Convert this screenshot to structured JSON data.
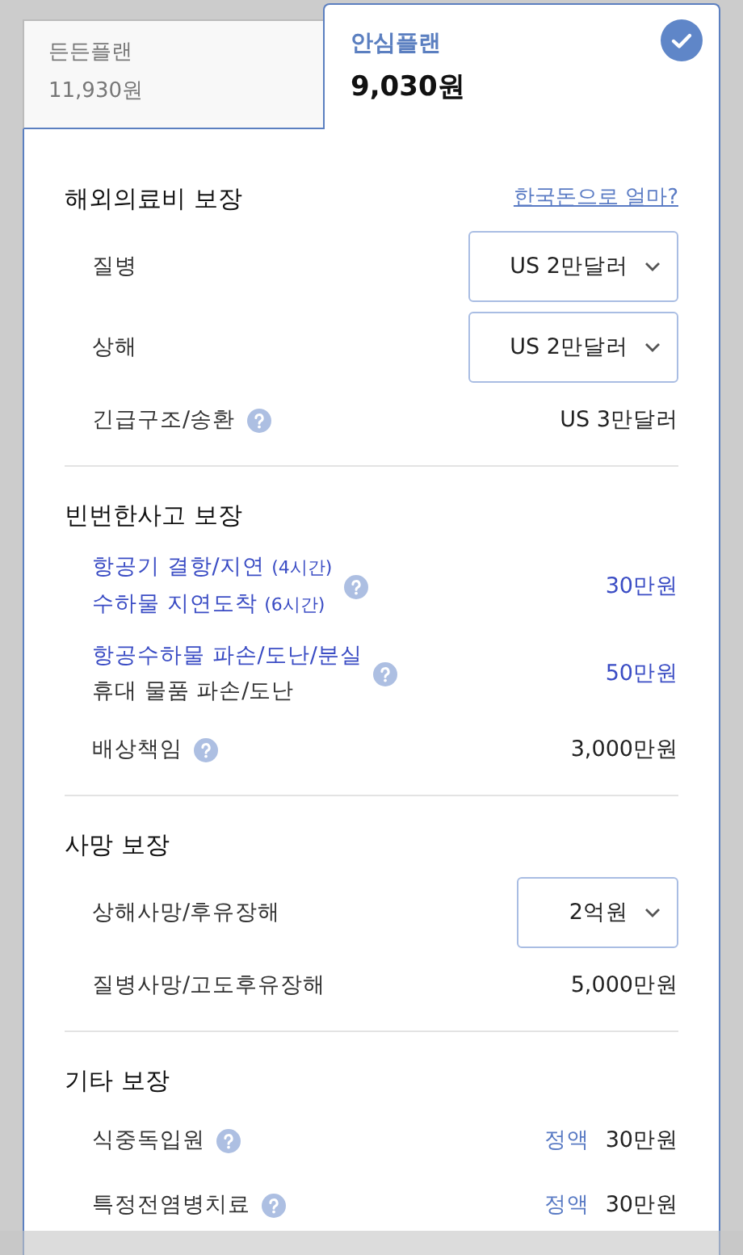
{
  "tabs": [
    {
      "name": "든든플랜",
      "price": "11,930원",
      "selected": false
    },
    {
      "name": "안심플랜",
      "price": "9,030원",
      "selected": true
    }
  ],
  "sections": [
    {
      "title": "해외의료비 보장",
      "link": "한국돈으로 얼마?",
      "items": [
        {
          "kind": "select",
          "lines": [
            {
              "text": "질병",
              "highlight": false
            }
          ],
          "help": false,
          "value": "US 2만달러",
          "highlight": false
        },
        {
          "kind": "select",
          "lines": [
            {
              "text": "상해",
              "highlight": false
            }
          ],
          "help": false,
          "value": "US 2만달러",
          "highlight": false
        },
        {
          "kind": "text",
          "lines": [
            {
              "text": "긴급구조/송환",
              "highlight": false
            }
          ],
          "help": true,
          "value": "US 3만달러",
          "highlight": false
        }
      ]
    },
    {
      "title": "빈번한사고 보장",
      "items": [
        {
          "kind": "text",
          "lines": [
            {
              "text": "항공기 결항/지연",
              "note": "(4시간)",
              "highlight": true
            },
            {
              "text": "수하물 지연도착",
              "note": "(6시간)",
              "highlight": true
            }
          ],
          "help": true,
          "value": "30만원",
          "highlight": true
        },
        {
          "kind": "text",
          "lines": [
            {
              "text": "항공수하물 파손/도난/분실",
              "highlight": true
            },
            {
              "text": "휴대 물품 파손/도난",
              "highlight": false
            }
          ],
          "help": true,
          "value": "50만원",
          "highlight": true
        },
        {
          "kind": "text",
          "lines": [
            {
              "text": "배상책임",
              "highlight": false
            }
          ],
          "help": true,
          "value": "3,000만원",
          "highlight": false
        }
      ]
    },
    {
      "title": "사망 보장",
      "items": [
        {
          "kind": "select",
          "lines": [
            {
              "text": "상해사망/후유장해",
              "highlight": false
            }
          ],
          "help": false,
          "value": "2억원",
          "highlight": false
        },
        {
          "kind": "text",
          "lines": [
            {
              "text": "질병사망/고도후유장해",
              "highlight": false
            }
          ],
          "help": false,
          "value": "5,000만원",
          "highlight": false
        }
      ]
    },
    {
      "title": "기타 보장",
      "items": [
        {
          "kind": "fixed",
          "lines": [
            {
              "text": "식중독입원",
              "highlight": false
            }
          ],
          "help": true,
          "prefix": "정액",
          "value": "30만원",
          "highlight": false
        },
        {
          "kind": "fixed",
          "lines": [
            {
              "text": "특정전염병치료",
              "highlight": false
            }
          ],
          "help": true,
          "prefix": "정액",
          "value": "30만원",
          "highlight": false
        }
      ]
    }
  ]
}
